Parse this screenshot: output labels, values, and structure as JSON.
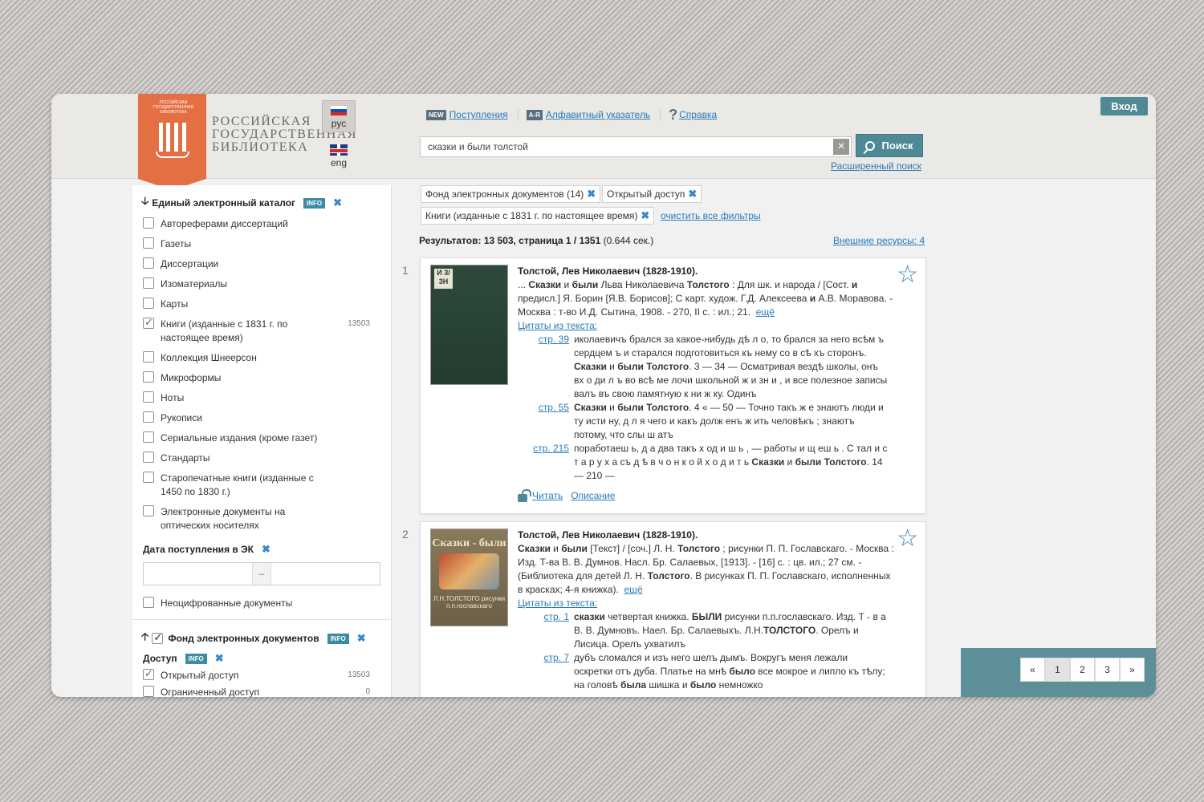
{
  "header": {
    "logo_small_text": "Российская государственная библиотека",
    "logo_title": "Российская государственная библиотека",
    "lang_ru": "рус",
    "lang_en": "eng",
    "links": [
      {
        "tag": "NEW",
        "label": "Поступления"
      },
      {
        "tag": "А-Я",
        "label": "Алфавитный указатель"
      },
      {
        "tag": "?",
        "label": "Справка"
      }
    ],
    "search_value": "сказки и были толстой",
    "search_button": "Поиск",
    "advanced_search": "Расширенный поиск",
    "login": "Вход"
  },
  "sidebar": {
    "catalog_title": "Единый электронный каталог",
    "info_label": "INFO",
    "items": [
      {
        "label": "Автореферами диссертаций",
        "checked": false,
        "count": ""
      },
      {
        "label": "Газеты",
        "checked": false,
        "count": ""
      },
      {
        "label": "Диссертации",
        "checked": false,
        "count": ""
      },
      {
        "label": "Изоматериалы",
        "checked": false,
        "count": ""
      },
      {
        "label": "Карты",
        "checked": false,
        "count": ""
      },
      {
        "label": "Книги (изданные с 1831 г. по настоящее время)",
        "checked": true,
        "count": "13503"
      },
      {
        "label": "Коллекция Шнеерсон",
        "checked": false,
        "count": ""
      },
      {
        "label": "Микроформы",
        "checked": false,
        "count": ""
      },
      {
        "label": "Ноты",
        "checked": false,
        "count": ""
      },
      {
        "label": "Рукописи",
        "checked": false,
        "count": ""
      },
      {
        "label": "Сериальные издания (кроме газет)",
        "checked": false,
        "count": ""
      },
      {
        "label": "Стандарты",
        "checked": false,
        "count": ""
      },
      {
        "label": "Старопечатные книги (изданные с 1450 по 1830 г.)",
        "checked": false,
        "count": ""
      },
      {
        "label": "Электронные документы на оптических носителях",
        "checked": false,
        "count": ""
      }
    ],
    "date_title": "Дата поступления в ЭК",
    "date_sep": "–",
    "undigitized": "Неоцифрованные документы",
    "fund_title": "Фонд электронных документов",
    "access_title": "Доступ",
    "access_items": [
      {
        "label": "Открытый доступ",
        "checked": true,
        "count": "13503"
      },
      {
        "label": "Ограниченный доступ",
        "checked": false,
        "count": "0"
      }
    ]
  },
  "filters": {
    "chips": [
      "Фонд электронных документов (14)",
      "Открытый доступ",
      "Книги (изданные с 1831 г. по настоящее время)"
    ],
    "clear_all": "очистить все фильтры"
  },
  "results": {
    "summary_bold": "Результатов: 13 503, страница 1 / 1351",
    "summary_time": "(0.644 сек.)",
    "external": "Внешние ресурсы: 4",
    "items": [
      {
        "num": "1",
        "author": "Толстой, Лев Николаевич (1828-1910).",
        "quotes_label": "Цитаты из текста:",
        "more": "ещё",
        "read": "Читать",
        "describe": "Описание",
        "cover_spine": "И 3/ 3Н",
        "pages": [
          "стр. 39",
          "стр. 55",
          "стр. 215"
        ]
      },
      {
        "num": "2",
        "author": "Толстой, Лев Николаевич (1828-1910).",
        "quotes_label": "Цитаты из текста:",
        "more": "ещё",
        "cover_title": "Сказки - были",
        "cover_sub": "Л.Н.ТОЛСТОГО рисунки п.п.гославскаго",
        "pages": [
          "стр. 1",
          "стр. 7"
        ]
      }
    ]
  },
  "pager": {
    "prev": "«",
    "pages": [
      "1",
      "2",
      "3"
    ],
    "next": "»",
    "current": "1"
  }
}
